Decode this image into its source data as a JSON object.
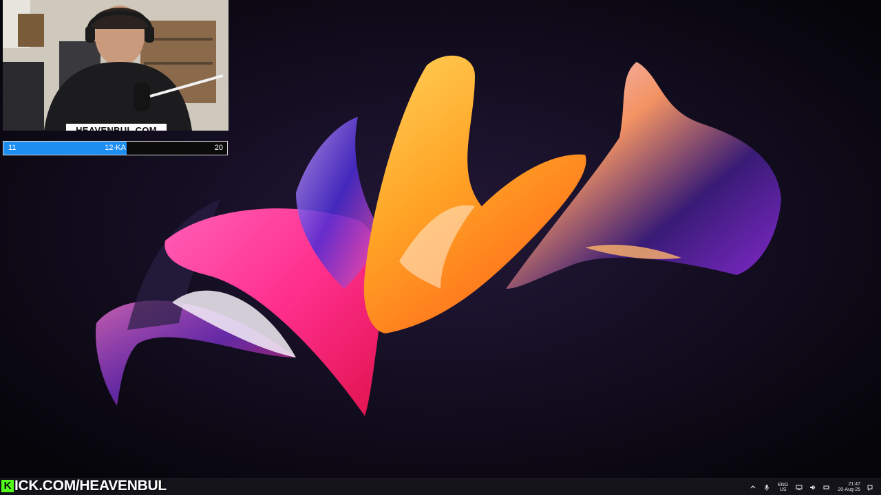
{
  "overlay": {
    "webcam_site": "HEAVENBUL.COM",
    "goal": {
      "start": "11",
      "label": "12-KA",
      "end": "20",
      "progress_percent": 55,
      "fill_color": "#1f8ef1"
    },
    "banner": {
      "logo_letter": "K",
      "text": "ICK.COM/HEAVENBUL",
      "logo_color": "#53fc18"
    }
  },
  "taskbar": {
    "tray": {
      "chevron_icon": "chevron-up-icon",
      "mic_icon": "microphone-icon",
      "lang_top": "ENG",
      "lang_bottom": "US",
      "network_icon": "network-icon",
      "volume_icon": "volume-icon",
      "battery_icon": "battery-icon",
      "time": "21:47",
      "date": "20-Aug-25",
      "notification_icon": "notification-icon"
    }
  }
}
